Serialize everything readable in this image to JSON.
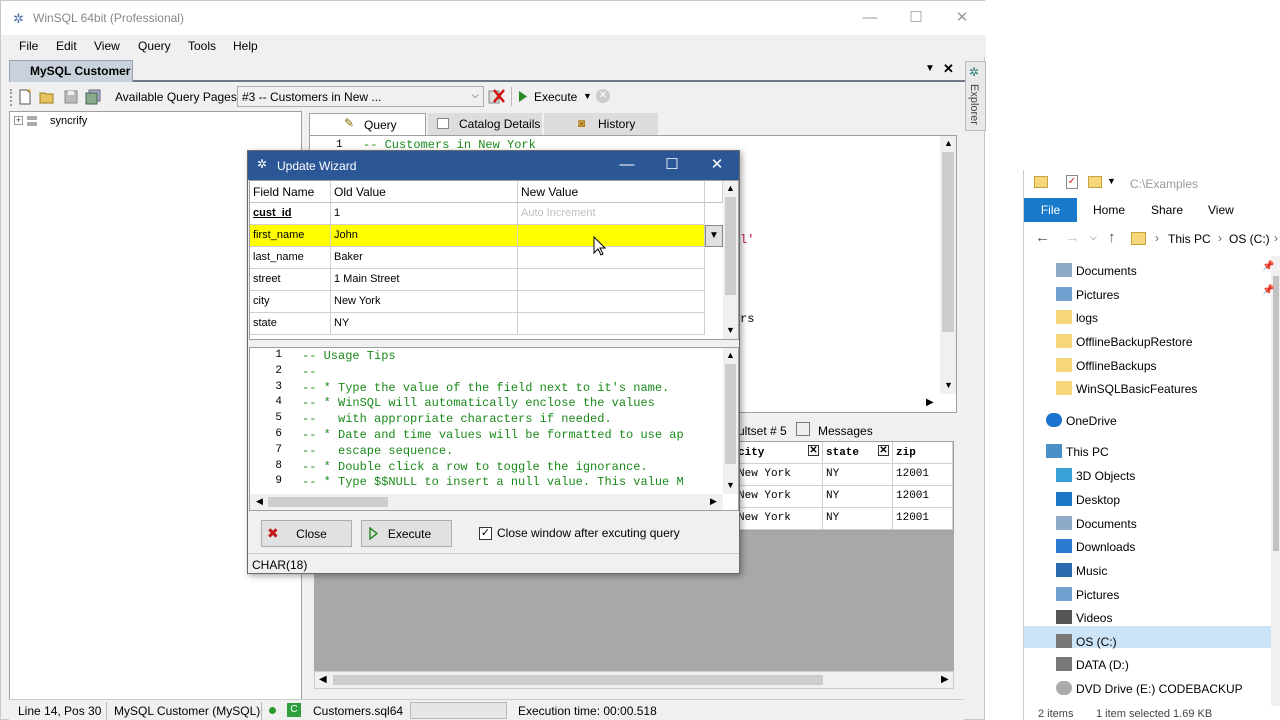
{
  "app": {
    "title": "WinSQL 64bit (Professional)",
    "menu": [
      "File",
      "Edit",
      "View",
      "Query",
      "Tools",
      "Help"
    ],
    "doc_tab": "MySQL Customer",
    "toolbar": {
      "pages_label": "Available Query Pages:",
      "page_selected": "#3 -- Customers in New ...",
      "execute_label": "Execute"
    },
    "tree": {
      "root": "syncrify"
    },
    "tabs": [
      "Query",
      "Catalog Details",
      "History"
    ],
    "editor": {
      "line1_num": "1",
      "line1_text": "-- Customers in New York",
      "frag_a": "l'",
      "frag_b": "rs"
    },
    "side_explorer_label": "Explorer",
    "result_tabs": [
      "ultset # 5",
      "Messages"
    ],
    "result_grid": {
      "headers": [
        "city",
        "state",
        "zip"
      ],
      "rows": [
        [
          "New York",
          "NY",
          "12001"
        ],
        [
          "New York",
          "NY",
          "12001"
        ],
        [
          "New York",
          "NY",
          "12001"
        ]
      ]
    },
    "status": {
      "pos": "Line 14, Pos 30",
      "conn": "MySQL Customer (MySQL)",
      "file": "Customers.sql64",
      "exec_time": "Execution time: 00:00.518"
    }
  },
  "wizard": {
    "title": "Update Wizard",
    "headers": [
      "Field Name",
      "Old Value",
      "New Value"
    ],
    "rows": [
      {
        "field": "cust_id",
        "old": "1",
        "new": "Auto Increment"
      },
      {
        "field": "first_name",
        "old": "John",
        "new": ""
      },
      {
        "field": "last_name",
        "old": "Baker",
        "new": ""
      },
      {
        "field": "street",
        "old": "1 Main Street",
        "new": ""
      },
      {
        "field": "city",
        "old": "New York",
        "new": ""
      },
      {
        "field": "state",
        "old": "NY",
        "new": ""
      }
    ],
    "tips": [
      {
        "n": "1",
        "t": "-- Usage Tips"
      },
      {
        "n": "2",
        "t": "--"
      },
      {
        "n": "3",
        "t": "-- * Type the value of the field next to it's name."
      },
      {
        "n": "4",
        "t": "-- * WinSQL will automatically enclose the values"
      },
      {
        "n": "5",
        "t": "--   with appropriate characters if needed."
      },
      {
        "n": "6",
        "t": "-- * Date and time values will be formatted to use ap"
      },
      {
        "n": "7",
        "t": "--   escape sequence."
      },
      {
        "n": "8",
        "t": "-- * Double click a row to toggle the ignorance."
      },
      {
        "n": "9",
        "t": "-- * Type $$NULL to insert a null value. This value M"
      }
    ],
    "close_label": "Close",
    "execute_label": "Execute",
    "checkbox_label": "Close window after excuting query",
    "status": "CHAR(18)"
  },
  "file_explorer": {
    "path_title": "C:\\Examples",
    "ribbon": [
      "File",
      "Home",
      "Share",
      "View"
    ],
    "breadcrumb": [
      "This PC",
      "OS (C:)"
    ],
    "items": [
      {
        "label": "Documents",
        "icon": "documents-icon"
      },
      {
        "label": "Pictures",
        "icon": "pictures-icon"
      },
      {
        "label": "logs",
        "icon": "folder-icon"
      },
      {
        "label": "OfflineBackupRestore",
        "icon": "folder-icon"
      },
      {
        "label": "OfflineBackups",
        "icon": "folder-icon"
      },
      {
        "label": "WinSQLBasicFeatures",
        "icon": "folder-icon"
      },
      {
        "label": "OneDrive",
        "icon": "cloud-icon"
      },
      {
        "label": "This PC",
        "icon": "computer-icon"
      },
      {
        "label": "3D Objects",
        "icon": "3d-objects-icon"
      },
      {
        "label": "Desktop",
        "icon": "desktop-icon"
      },
      {
        "label": "Documents",
        "icon": "documents-icon"
      },
      {
        "label": "Downloads",
        "icon": "downloads-icon"
      },
      {
        "label": "Music",
        "icon": "music-icon"
      },
      {
        "label": "Pictures",
        "icon": "pictures-icon"
      },
      {
        "label": "Videos",
        "icon": "videos-icon"
      },
      {
        "label": "OS (C:)",
        "icon": "drive-icon"
      },
      {
        "label": "DATA (D:)",
        "icon": "drive-icon"
      },
      {
        "label": "DVD Drive (E:) CODEBACKUP",
        "icon": "dvd-icon"
      }
    ],
    "status": [
      "2 items",
      "1 item selected  1.69 KB"
    ]
  },
  "colors": {
    "wizard_title": "#2b5797",
    "highlight_row": "#ffff00",
    "comment_green": "#1a8a1a",
    "ribbon_blue": "#1979ca"
  }
}
